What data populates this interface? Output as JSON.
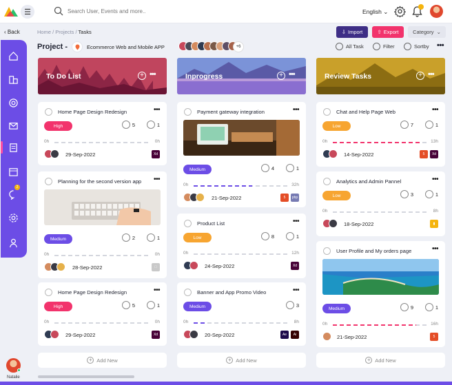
{
  "header": {
    "search_placeholder": "Search User, Events and more..",
    "language": "English"
  },
  "nav": {
    "back": "Back",
    "crumbs": [
      "Home",
      "Projects",
      "Tasks"
    ],
    "separator": "/"
  },
  "actions": {
    "import": "Import",
    "export": "Export",
    "category": "Category"
  },
  "project": {
    "label": "Project -",
    "name": "Ecommerce Web and Mobile APP",
    "team_more": "+6"
  },
  "tools": {
    "all_task": "All Task",
    "filter": "Filter",
    "sortby": "Sortby"
  },
  "colors": {
    "accent": "#6c4de6",
    "high": "#f2336c",
    "medium": "#6c4de6",
    "low": "#f7a531",
    "progress_pink": "#f2336c",
    "progress_purple": "#6c4de6",
    "progress_orange": "#f7a531"
  },
  "columns": [
    {
      "title": "To Do List",
      "add_new": "Add New",
      "cards": [
        {
          "title": "Home Page Design Redesign",
          "priority": "High",
          "comments": "5",
          "links": "1",
          "start": "0h",
          "end": "0h",
          "progress": 0,
          "date": "29-Sep-2022",
          "app": "xd-icon"
        },
        {
          "title": "Planning for the second version app",
          "priority": "Medium",
          "comments": "2",
          "links": "1",
          "start": "0h",
          "end": "0h",
          "progress": 0,
          "date": "28-Sep-2022",
          "app": "apple-icon"
        },
        {
          "title": "Home Page Design Redesign",
          "priority": "High",
          "comments": "5",
          "links": "1",
          "start": "0h",
          "end": "0h",
          "progress": 0,
          "date": "29-Sep-2022",
          "app": "xd-icon"
        }
      ]
    },
    {
      "title": "Inprogress",
      "add_new": "Add New",
      "cards": [
        {
          "title": "Payment gateway integration",
          "priority": "Medium",
          "comments": "4",
          "links": "1",
          "start": "0h",
          "end": "32h",
          "progress": 0.62,
          "date": "21-Sep-2022",
          "app": "html-php-icons"
        },
        {
          "title": "Product List",
          "priority": "Low",
          "comments": "8",
          "links": "1",
          "start": "0h",
          "end": "12h",
          "progress": 0,
          "date": "24-Sep-2022",
          "app": "xd-icon"
        },
        {
          "title": "Banner and App Promo Video",
          "priority": "Medium",
          "comments": "3",
          "start": "0h",
          "end": "8h",
          "progress": 0.12,
          "date": "20-Sep-2022",
          "app": "ae-ai-icons"
        }
      ]
    },
    {
      "title": "Review Tasks",
      "add_new": "Add New",
      "cards": [
        {
          "title": "Chat and Help Page Web",
          "priority": "Low",
          "comments": "7",
          "links": "1",
          "start": "0h",
          "end": "13h",
          "progress": 0.92,
          "date": "14-Sep-2022",
          "app": "html-xd-icons"
        },
        {
          "title": "Analytics and Admin Pannel",
          "priority": "Low",
          "comments": "3",
          "links": "1",
          "start": "0h",
          "end": "8h",
          "progress": 0,
          "date": "18-Sep-2022",
          "app": "chart-icon"
        },
        {
          "title": "User Profile and My orders page",
          "priority": "Medium",
          "comments": "9",
          "links": "1",
          "start": "0h",
          "end": "16h",
          "progress": 0.88,
          "date": "21-Sep-2022",
          "app": "html-icon"
        }
      ]
    }
  ],
  "user": {
    "name": "Natalie",
    "notification_count": "2"
  }
}
